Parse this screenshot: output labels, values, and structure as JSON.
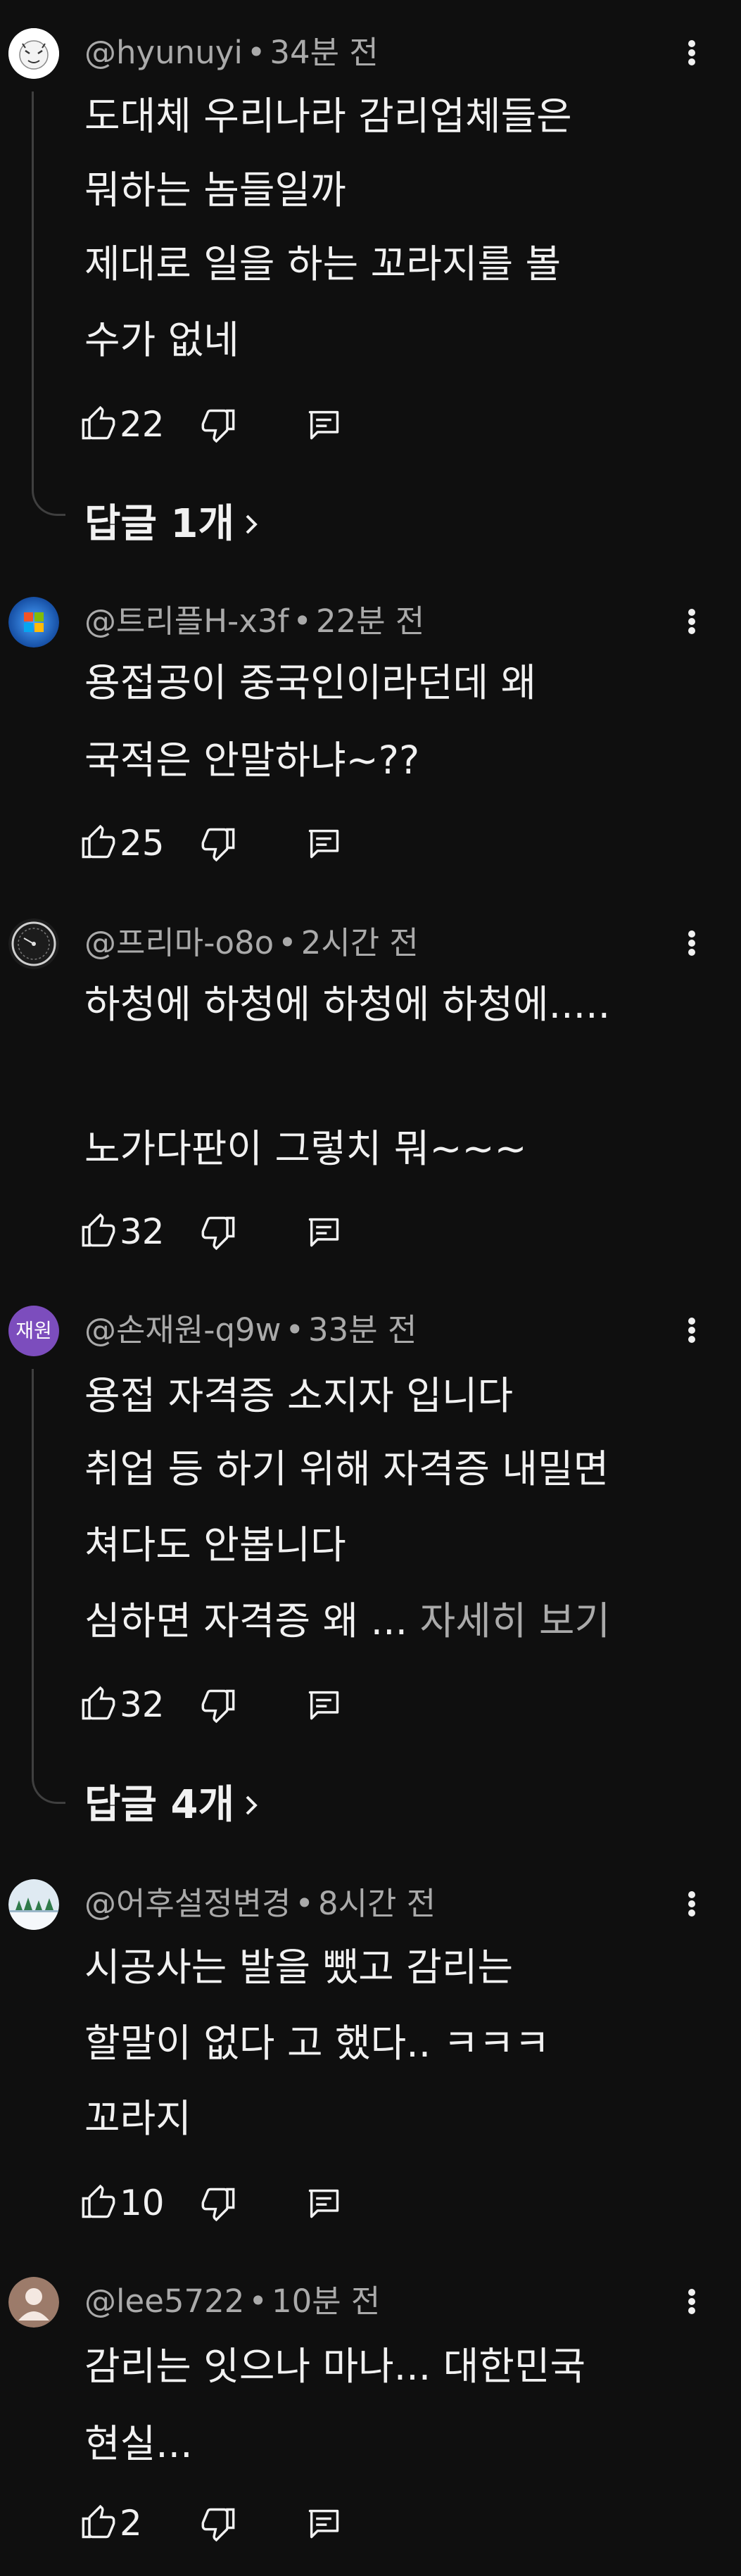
{
  "comments": [
    {
      "author": "@hyunuyi",
      "time": "34분 전",
      "lines": [
        "도대체 우리나라 감리업체들은",
        "뭐하는 놈들일까",
        "제대로 일을 하는 꼬라지를 볼",
        "수가 없네"
      ],
      "likes": "22",
      "replies_label": "답글 1개"
    },
    {
      "author": "@트리플H-x3f",
      "time": "22분 전",
      "lines": [
        "용접공이 중국인이라던데 왜",
        "국적은 안말하냐~??"
      ],
      "likes": "25"
    },
    {
      "author": "@프리마-o8o",
      "time": "2시간 전",
      "lines": [
        "하청에 하청에 하청에 하청에.....",
        "",
        "노가다판이 그렇치 뭐~~~"
      ],
      "likes": "32"
    },
    {
      "author": "@손재원-q9w",
      "time": "33분 전",
      "avatar_text": "재원",
      "lines": [
        "용접 자격증 소지자 입니다",
        "취업 등 하기 위해 자격증 내밀면",
        "쳐다도 안봅니다",
        "심하면 자격증 왜 ..."
      ],
      "read_more": " 자세히 보기",
      "likes": "32",
      "replies_label": "답글 4개"
    },
    {
      "author": "@어후설정변경",
      "time": "8시간 전",
      "lines": [
        "시공사는 발을 뺐고 감리는",
        "할말이 없다 고 했다.. ㅋㅋㅋ",
        "꼬라지"
      ],
      "likes": "10"
    },
    {
      "author": "@lee5722",
      "time": "10분 전",
      "lines": [
        "감리는 잇으나 마나...   대한민국",
        "현실..."
      ],
      "likes": "2"
    }
  ],
  "colors": {
    "background": "#0f0f0f",
    "text_primary": "#f1f1f1",
    "text_secondary": "#aaaaaa",
    "thread_line": "#3f3f3f",
    "avatar_purple": "#7c4dbd"
  },
  "icons": {
    "like": "thumbs-up-icon",
    "dislike": "thumbs-down-icon",
    "reply": "comment-icon",
    "more": "more-vertical-icon",
    "replies_arrow": "chevron-right-icon"
  }
}
